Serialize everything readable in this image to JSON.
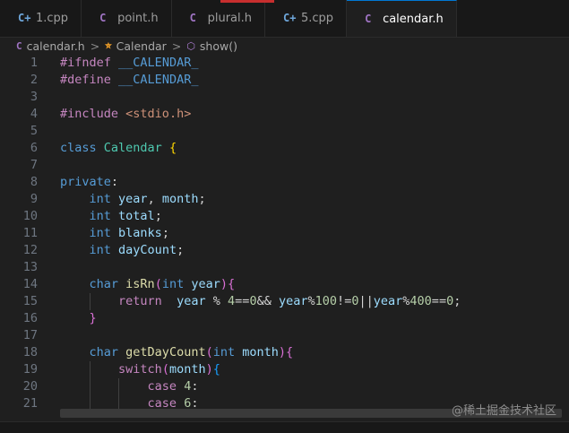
{
  "tabs": [
    {
      "label": "1.cpp",
      "icon": "cpp-icon",
      "active": false
    },
    {
      "label": "point.h",
      "icon": "c-header-icon",
      "active": false
    },
    {
      "label": "plural.h",
      "icon": "c-header-icon",
      "active": false
    },
    {
      "label": "5.cpp",
      "icon": "cpp-icon",
      "active": false
    },
    {
      "label": "calendar.h",
      "icon": "c-header-icon",
      "active": true
    }
  ],
  "breadcrumb": {
    "file": "calendar.h",
    "class": "Calendar",
    "method": "show()"
  },
  "watermark": "@稀土掘金技术社区",
  "colors": {
    "background": "#1f1f1f",
    "tab_accent": "#0078d4",
    "keyword": "#569cd6",
    "type": "#4ec9b0",
    "variable": "#9cdcfe",
    "function": "#dcdcaa",
    "number": "#b5cea8"
  },
  "code_lines": [
    {
      "n": "1",
      "text": "#ifndef __CALENDAR_"
    },
    {
      "n": "2",
      "text": "#define __CALENDAR_"
    },
    {
      "n": "3",
      "text": ""
    },
    {
      "n": "4",
      "text": "#include <stdio.h>"
    },
    {
      "n": "5",
      "text": ""
    },
    {
      "n": "6",
      "text": "class Calendar {"
    },
    {
      "n": "7",
      "text": ""
    },
    {
      "n": "8",
      "text": "private:"
    },
    {
      "n": "9",
      "text": "    int year, month;"
    },
    {
      "n": "10",
      "text": "    int total;"
    },
    {
      "n": "11",
      "text": "    int blanks;"
    },
    {
      "n": "12",
      "text": "    int dayCount;"
    },
    {
      "n": "13",
      "text": ""
    },
    {
      "n": "14",
      "text": "    char isRn(int year){"
    },
    {
      "n": "15",
      "text": "        return  year % 4==0&& year%100!=0||year%400==0;"
    },
    {
      "n": "16",
      "text": "    }"
    },
    {
      "n": "17",
      "text": ""
    },
    {
      "n": "18",
      "text": "    char getDayCount(int month){"
    },
    {
      "n": "19",
      "text": "        switch(month){"
    },
    {
      "n": "20",
      "text": "            case 4:"
    },
    {
      "n": "21",
      "text": "            case 6:"
    }
  ]
}
